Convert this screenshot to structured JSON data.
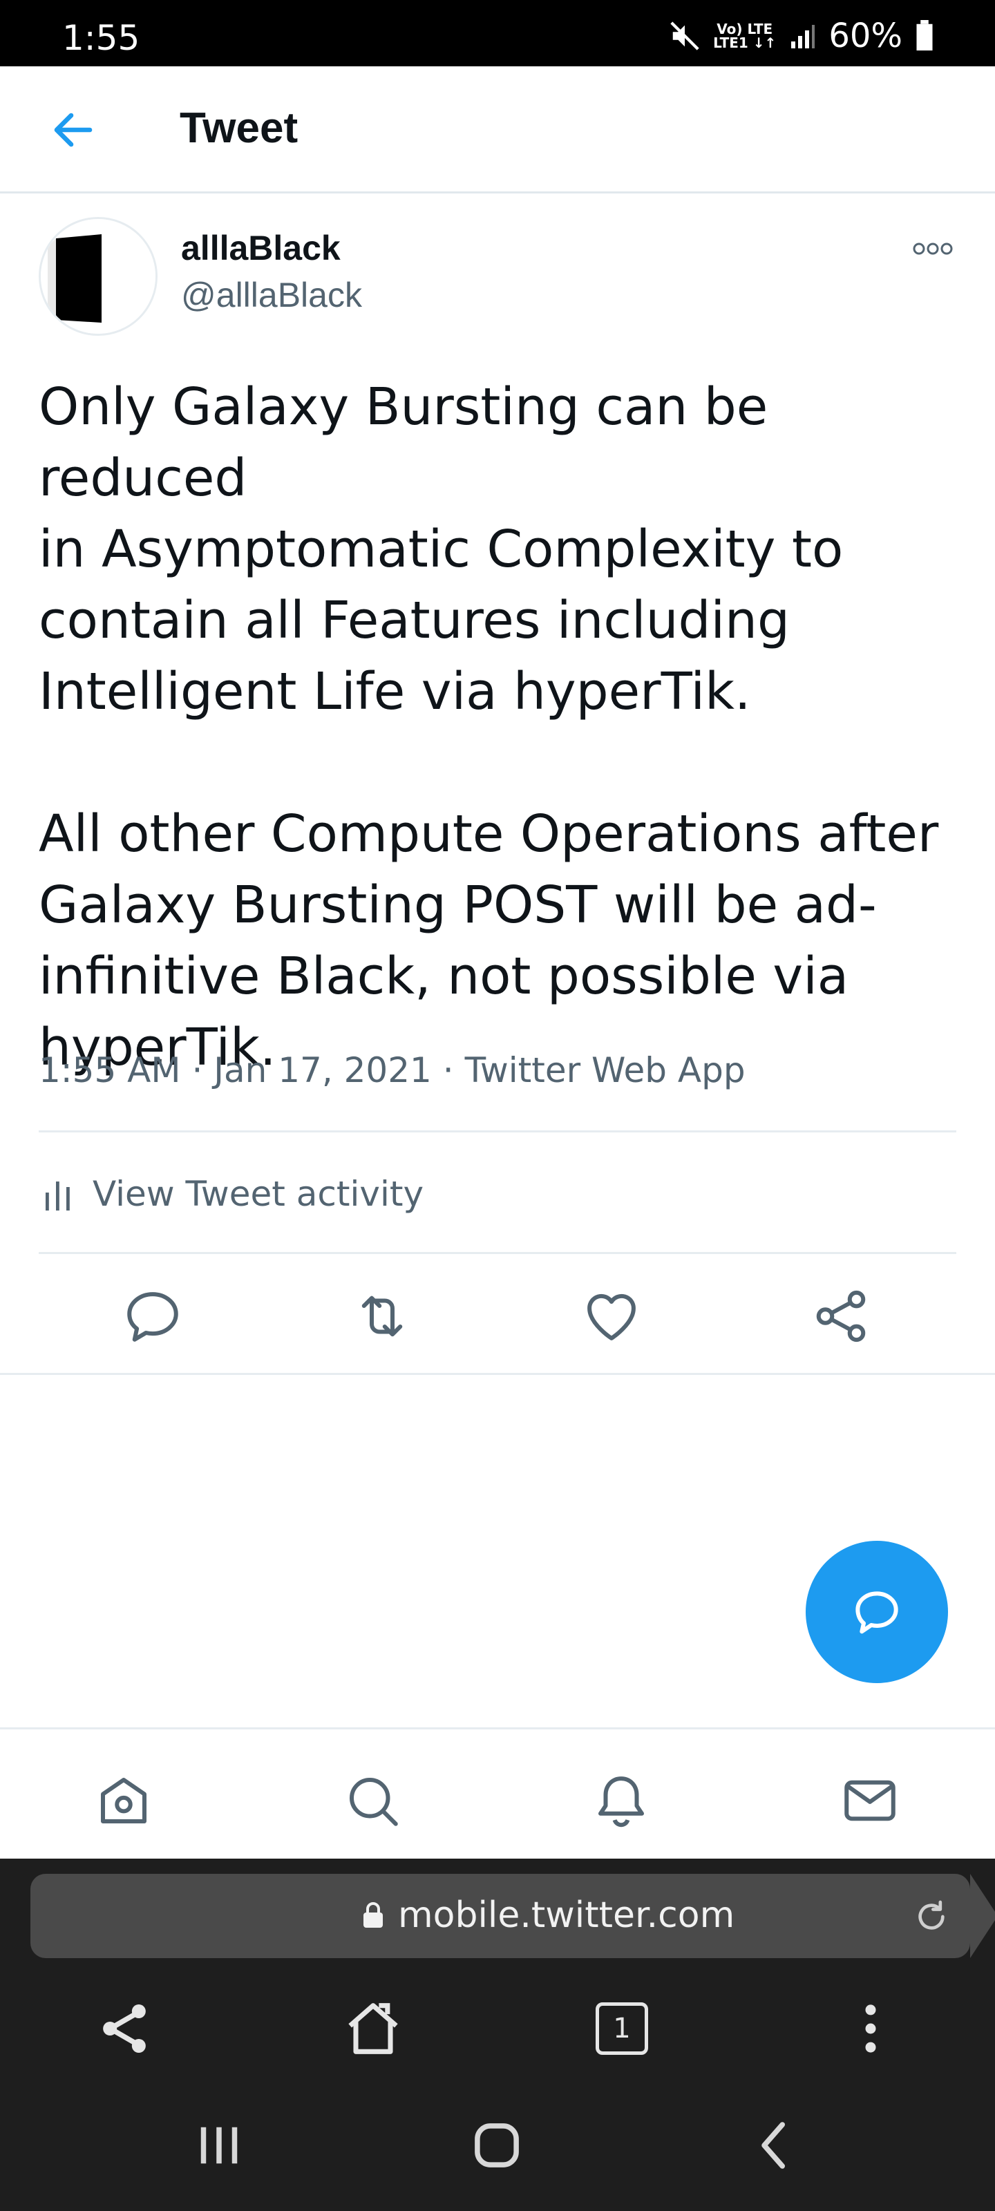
{
  "status_bar": {
    "time": "1:55",
    "network_top": "Vo) LTE",
    "network_bottom": "LTE1 ↓↑",
    "battery": "60%"
  },
  "header": {
    "title": "Tweet"
  },
  "tweet": {
    "display_name": "alllaBlack",
    "handle": "@alllaBlack",
    "text": "Only Galaxy Bursting can be reduced\nin Asymptomatic Complexity to\ncontain all Features including\nIntelligent Life via hyperTik.\n\nAll other Compute Operations after\nGalaxy Bursting POST will be ad-\ninfinitive Black, not possible via\nhyperTik.",
    "time": "1:55 AM",
    "date": "Jan 17, 2021",
    "source": "Twitter Web App"
  },
  "activity": {
    "label": "View Tweet activity"
  },
  "browser": {
    "url": "mobile.twitter.com",
    "tab_count": "1"
  },
  "colors": {
    "accent": "#1d9bf0",
    "secondary_text": "#536471",
    "browser_bar": "#1e1e1e"
  },
  "icons": {
    "header": "back-arrow-icon",
    "actions": [
      "reply-icon",
      "retweet-icon",
      "like-icon",
      "share-icon"
    ],
    "nav": [
      "home-icon",
      "search-icon",
      "notifications-icon",
      "messages-icon"
    ],
    "browser": [
      "share-icon",
      "home-icon",
      "tabs-icon",
      "menu-icon"
    ],
    "system": [
      "recents-icon",
      "home-icon",
      "back-icon"
    ]
  }
}
